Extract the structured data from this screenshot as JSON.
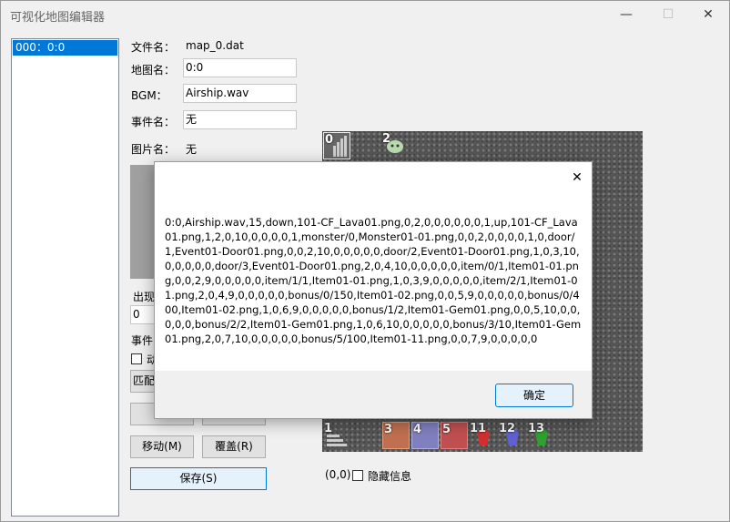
{
  "window": {
    "title": "可视化地图编辑器",
    "minimize_glyph": "—",
    "maximize_glyph": "☐",
    "close_glyph": "✕"
  },
  "map_list": {
    "items": [
      "000：0:0"
    ]
  },
  "form": {
    "file_label": "文件名：",
    "file_value": "map_0.dat",
    "mapname_label": "地图名：",
    "mapname_value": "0:0",
    "bgm_label": "BGM：",
    "bgm_value": "Airship.wav",
    "event_label": "事件名：",
    "event_value": "无",
    "image_label": "图片名：",
    "image_value": "无",
    "appear_label": "出现",
    "appear_value": "0",
    "event_section_label": "事件",
    "anim_checkbox_label": "动",
    "match_button": "匹配",
    "copy_button": "复",
    "move_button": "移动(M)",
    "cover_button": "覆盖(R)",
    "save_button": "保存(S)"
  },
  "map": {
    "coords": "(0,0)",
    "hide_info_label": "隐藏信息",
    "tile_numbers": [
      "0",
      "2",
      "1",
      "3",
      "4",
      "5",
      "11",
      "12",
      "13"
    ]
  },
  "dialog": {
    "close_glyph": "✕",
    "text": "0:0,Airship.wav,15,down,101-CF_Lava01.png,0,2,0,0,0,0,0,0,1,up,101-CF_Lava01.png,1,2,0,10,0,0,0,0,1,monster/0,Monster01-01.png,0,0,2,0,0,0,0,1,0,door/1,Event01-Door01.png,0,0,2,10,0,0,0,0,0,door/2,Event01-Door01.png,1,0,3,10,0,0,0,0,0,door/3,Event01-Door01.png,2,0,4,10,0,0,0,0,0,item/0/1,Item01-01.png,0,0,2,9,0,0,0,0,0,item/1/1,Item01-01.png,1,0,3,9,0,0,0,0,0,item/2/1,Item01-01.png,2,0,4,9,0,0,0,0,0,bonus/0/150,Item01-02.png,0,0,5,9,0,0,0,0,0,bonus/0/400,Item01-02.png,1,0,6,9,0,0,0,0,0,bonus/1/2,Item01-Gem01.png,0,0,5,10,0,0,0,0,0,bonus/2/2,Item01-Gem01.png,1,0,6,10,0,0,0,0,0,bonus/3/10,Item01-Gem01.png,2,0,7,10,0,0,0,0,0,bonus/5/100,Item01-11.png,0,0,7,9,0,0,0,0,0",
    "ok_button": "确定"
  }
}
